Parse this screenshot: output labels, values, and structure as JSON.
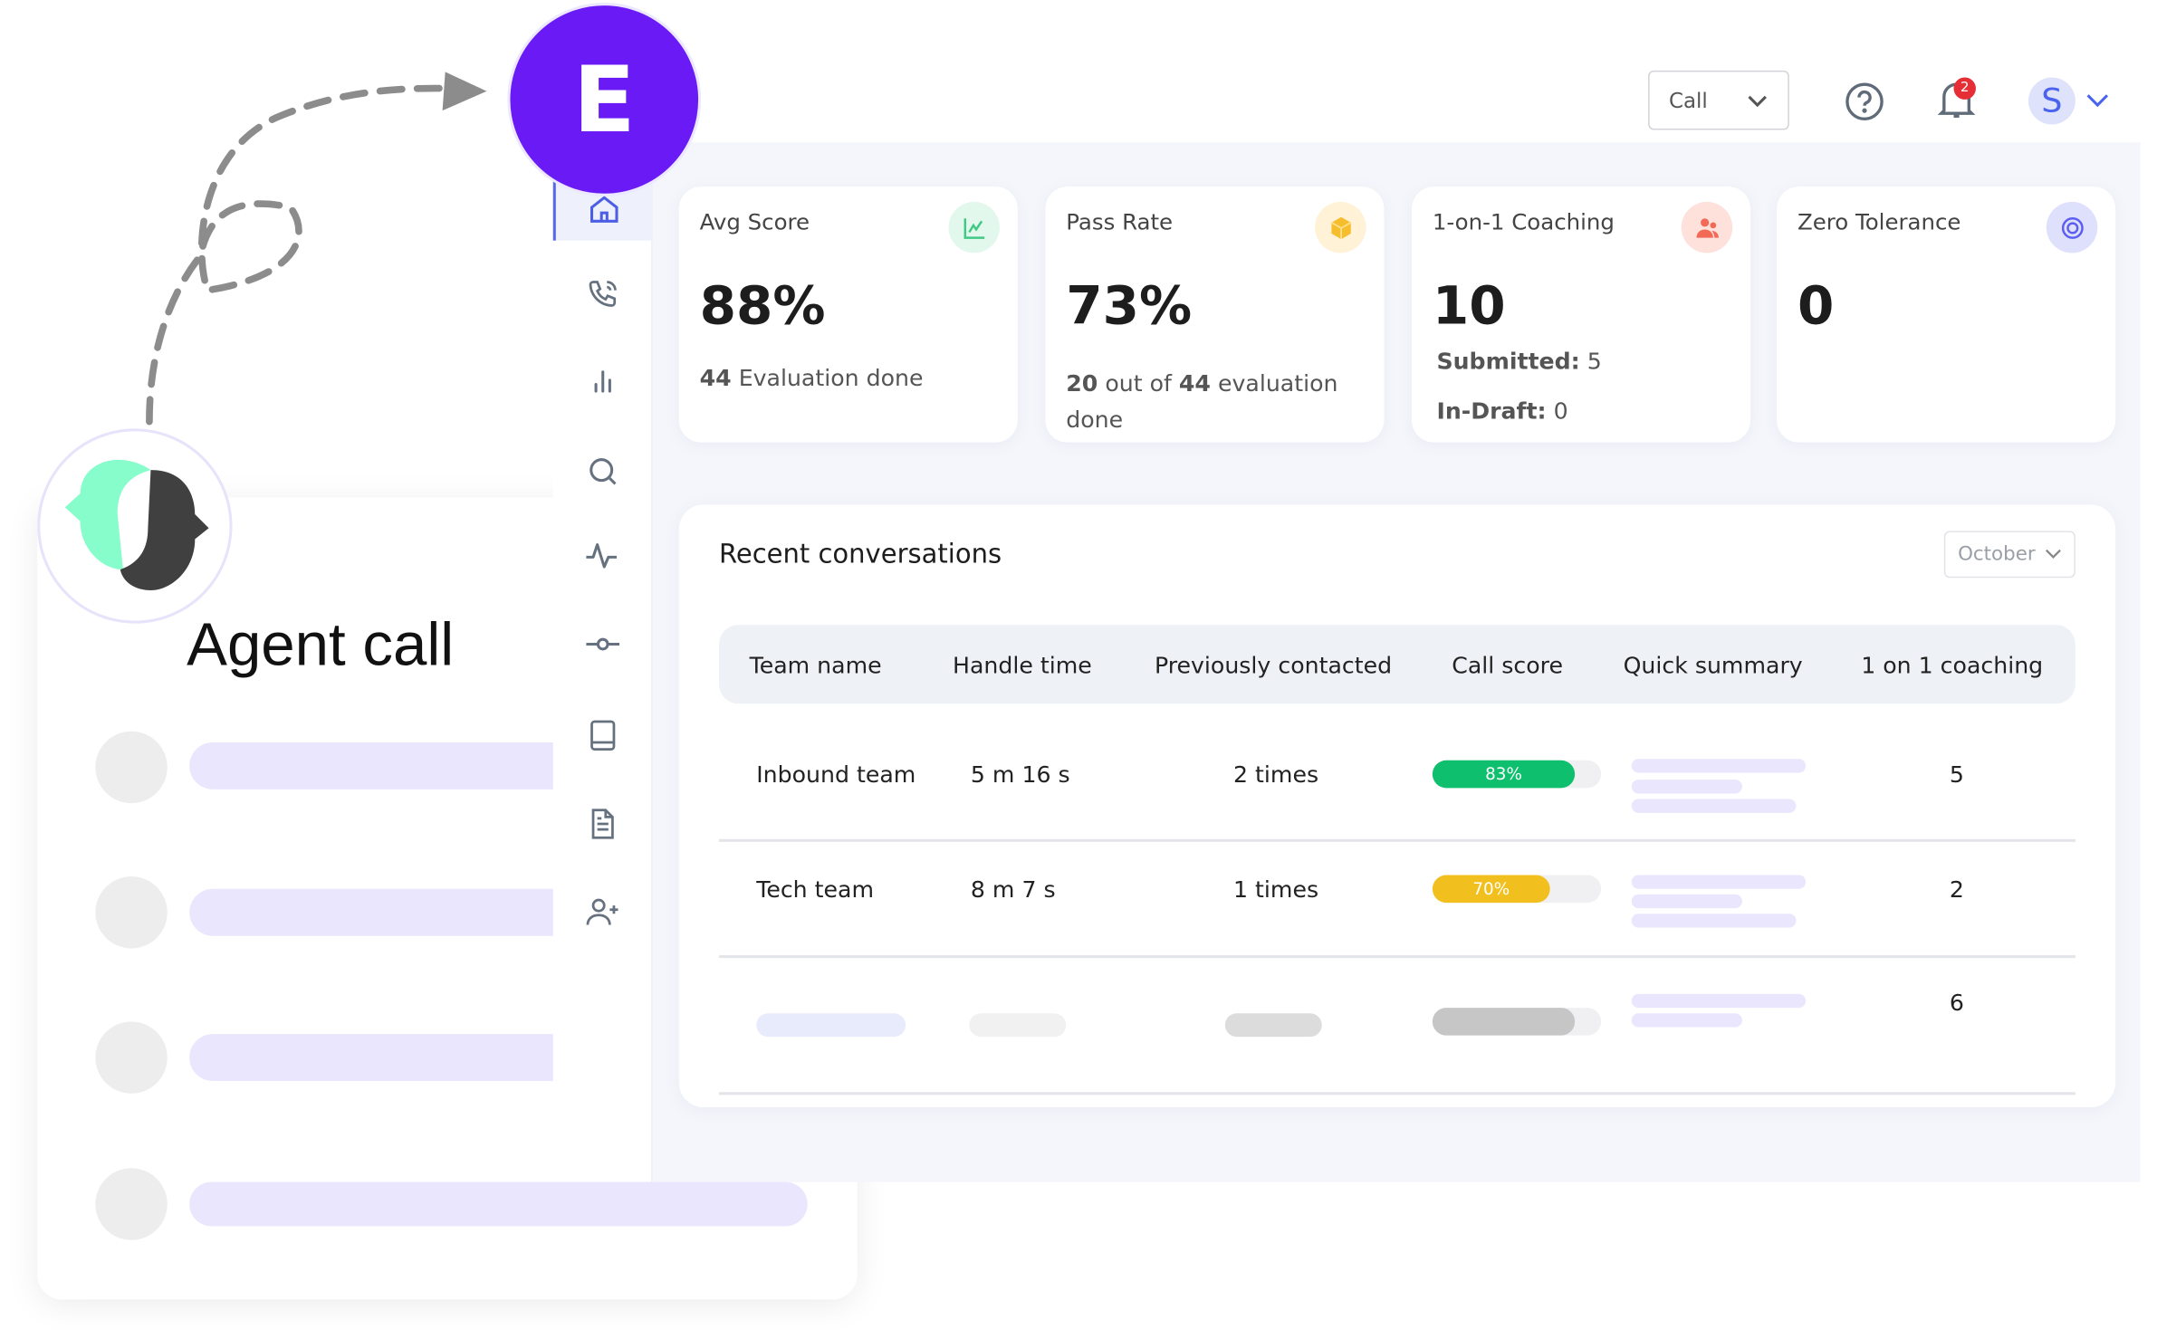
{
  "brand": {
    "letter": "E",
    "color": "#6a1bf5"
  },
  "left_panel": {
    "title": "Agent call"
  },
  "topbar": {
    "channel_select": "Call",
    "notifications_count": "2",
    "avatar_initial": "S"
  },
  "sidebar": {
    "items": [
      {
        "icon": "home-icon",
        "active": true
      },
      {
        "icon": "phone-call-icon"
      },
      {
        "icon": "bar-chart-icon"
      },
      {
        "icon": "search-icon"
      },
      {
        "icon": "activity-icon"
      },
      {
        "icon": "commit-icon"
      },
      {
        "icon": "book-icon"
      },
      {
        "icon": "document-icon"
      },
      {
        "icon": "user-plus-icon"
      }
    ]
  },
  "cards": [
    {
      "title": "Avg Score",
      "value": "88%",
      "line1_num": "44",
      "line1_text": " Evaluation done",
      "badge_color": "#e3f8ec",
      "icon": "line-chart-icon"
    },
    {
      "title": "Pass Rate",
      "value": "73%",
      "line1_num": "20",
      "line1_mid": " out of ",
      "line1_num2": "44",
      "line1_text": " evaluation done",
      "badge_color": "#fff2d6",
      "icon": "box-icon"
    },
    {
      "title": "1-on-1 Coaching",
      "value": "10",
      "submitted_label": "Submitted:",
      "submitted": "5",
      "draft_label": "In-Draft:",
      "draft": "0",
      "badge_color": "#ffe1dc",
      "icon": "users-icon"
    },
    {
      "title": "Zero Tolerance",
      "value": "0",
      "badge_color": "#dfe0fb",
      "icon": "target-icon"
    }
  ],
  "recent": {
    "title": "Recent conversations",
    "month": "October",
    "columns": [
      "Team name",
      "Handle time",
      "Previously contacted",
      "Call score",
      "Quick summary",
      "1 on 1 coaching"
    ],
    "rows": [
      {
        "team": "Inbound team",
        "handle": "5 m 16 s",
        "contacted": "2 times",
        "score": "83%",
        "score_value": 83,
        "score_color": "#0ec06d",
        "coaching": "5"
      },
      {
        "team": "Tech team",
        "handle": "8 m 7 s",
        "contacted": "1 times",
        "score": "70%",
        "score_value": 70,
        "score_color": "#f2c01e",
        "coaching": "2"
      },
      {
        "coaching": "6"
      }
    ]
  }
}
